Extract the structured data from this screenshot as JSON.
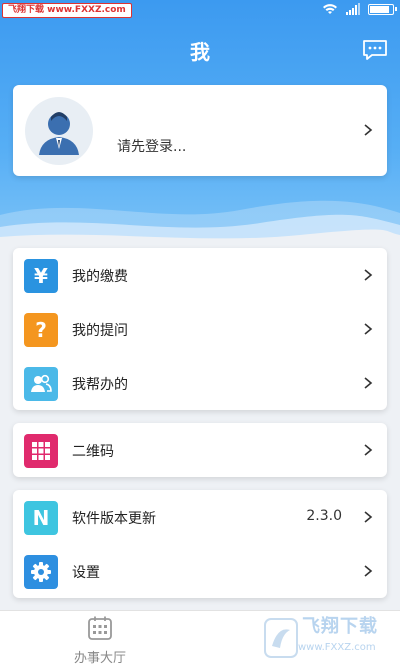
{
  "status_bar": {
    "watermark": "飞翔下载 www.FXXZ.com",
    "battery_level": 0.9
  },
  "header": {
    "title": "我",
    "message_icon": "chat-bubble-icon"
  },
  "profile": {
    "login_prompt": "请先登录...",
    "avatar_icon": "user-avatar-icon"
  },
  "menu_group_1": [
    {
      "label": "我的缴费",
      "icon": "yen-icon",
      "glyph": "¥",
      "color": "#2a93e0"
    },
    {
      "label": "我的提问",
      "icon": "question-icon",
      "glyph": "?",
      "color": "#f4961f"
    },
    {
      "label": "我帮办的",
      "icon": "users-icon",
      "glyph": "",
      "color": "#4bb9e8"
    }
  ],
  "menu_group_2": [
    {
      "label": "二维码",
      "icon": "grid-icon",
      "glyph": "",
      "color": "#e02a6d"
    }
  ],
  "menu_group_3": [
    {
      "label": "软件版本更新",
      "icon": "n-icon",
      "glyph": "N",
      "color": "#3ec5e0",
      "value": "2.3.0"
    },
    {
      "label": "设置",
      "icon": "gear-icon",
      "glyph": "",
      "color": "#2e8fe0"
    }
  ],
  "bottom_nav": {
    "tab1_label": "办事大厅",
    "tab1_icon": "calendar-icon"
  },
  "watermark_bottom": {
    "brand": "飞翔下载",
    "url": "www.FXXZ.com"
  }
}
